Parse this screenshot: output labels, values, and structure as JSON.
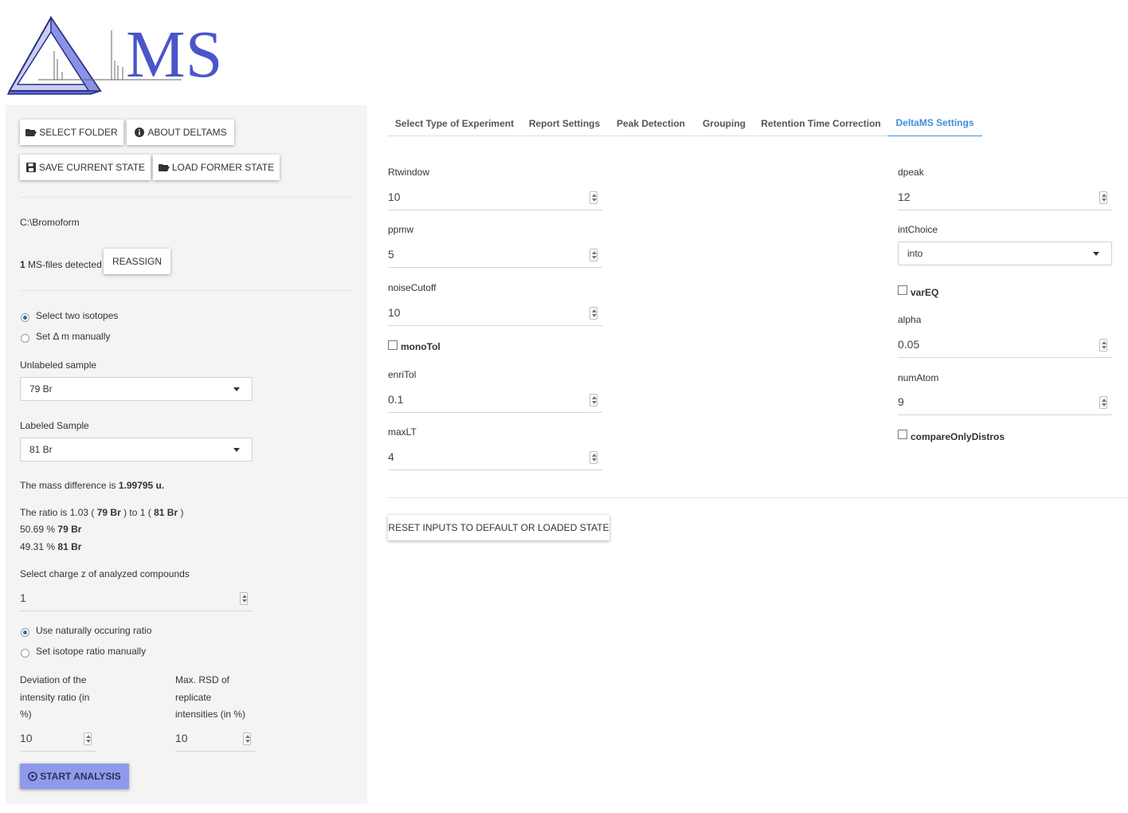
{
  "app": {
    "logo_text": "MS"
  },
  "toolbar": {
    "select_folder_label": "SELECT FOLDER",
    "about_label": "ABOUT DELTAMS",
    "save_state_label": "SAVE CURRENT STATE",
    "load_state_label": "LOAD FORMER STATE",
    "folder_icon": "folder-open-icon",
    "info_icon": "info-circle-icon",
    "save_icon": "floppy-disk-icon"
  },
  "files": {
    "path": "C:\\Bromoform",
    "count": "1",
    "detected_text": "MS-files detected",
    "reassign_label": "REASSIGN"
  },
  "isotope_mode": {
    "option_two": "Select two isotopes",
    "option_manual": "Set Δ m manually",
    "selected": "two"
  },
  "unlabeled": {
    "label": "Unlabeled sample",
    "value": "79 Br"
  },
  "labeled": {
    "label": "Labeled Sample",
    "value": "81 Br"
  },
  "mass": {
    "prefix": "The mass difference is",
    "value": "1.99795 u."
  },
  "ratio": {
    "prefix": "The ratio is 1.03 (",
    "iso_a": "79 Br",
    "middle": ") to 1 (",
    "iso_b": "81 Br",
    "suffix": ")",
    "pct_a": "50.69 %",
    "pct_b": "49.31 %"
  },
  "charge": {
    "label": "Select charge z of analyzed compounds",
    "value": "1"
  },
  "ratio_mode": {
    "option_natural": "Use naturally occuring ratio",
    "option_manual": "Set isotope ratio manually",
    "selected": "natural"
  },
  "deviation": {
    "label_1": "Deviation of the",
    "label_2": "intensity ratio (in",
    "label_3": "%)",
    "value": "10"
  },
  "rsd": {
    "label_1": "Max. RSD of",
    "label_2": "replicate",
    "label_3": "intensities (in %)",
    "value": "10"
  },
  "start": {
    "label": "START ANALYSIS",
    "icon": "play-circle-icon"
  },
  "tabs": [
    {
      "label": "Select Type of Experiment"
    },
    {
      "label": "Report Settings"
    },
    {
      "label": "Peak Detection"
    },
    {
      "label": "Grouping"
    },
    {
      "label": "Retention Time Correction"
    },
    {
      "label": "DeltaMS Settings"
    }
  ],
  "active_tab": "DeltaMS Settings",
  "settings_left": {
    "rtwindow": {
      "label": "Rtwindow",
      "value": "10"
    },
    "ppmw": {
      "label": "ppmw",
      "value": "5"
    },
    "noisecutoff": {
      "label": "noiseCutoff",
      "value": "10"
    },
    "monotol": {
      "label": "monoTol",
      "checked": false
    },
    "enritol": {
      "label": "enriTol",
      "value": "0.1"
    },
    "maxlt": {
      "label": "maxLT",
      "value": "4"
    }
  },
  "settings_right": {
    "dpeak": {
      "label": "dpeak",
      "value": "12"
    },
    "intchoice": {
      "label": "intChoice",
      "value": "into"
    },
    "vareq": {
      "label": "varEQ",
      "checked": false
    },
    "alpha": {
      "label": "alpha",
      "value": "0.05"
    },
    "numatom": {
      "label": "numAtom",
      "value": "9"
    },
    "compareonly": {
      "label": "compareOnlyDistros",
      "checked": false
    }
  },
  "reset": {
    "label": "RESET INPUTS TO DEFAULT OR LOADED STATE"
  },
  "colors": {
    "accent": "#3f8fd8",
    "start_button": "#8f9bea",
    "logo": "#4a56c8",
    "sidebar": "#f4f4f4"
  }
}
